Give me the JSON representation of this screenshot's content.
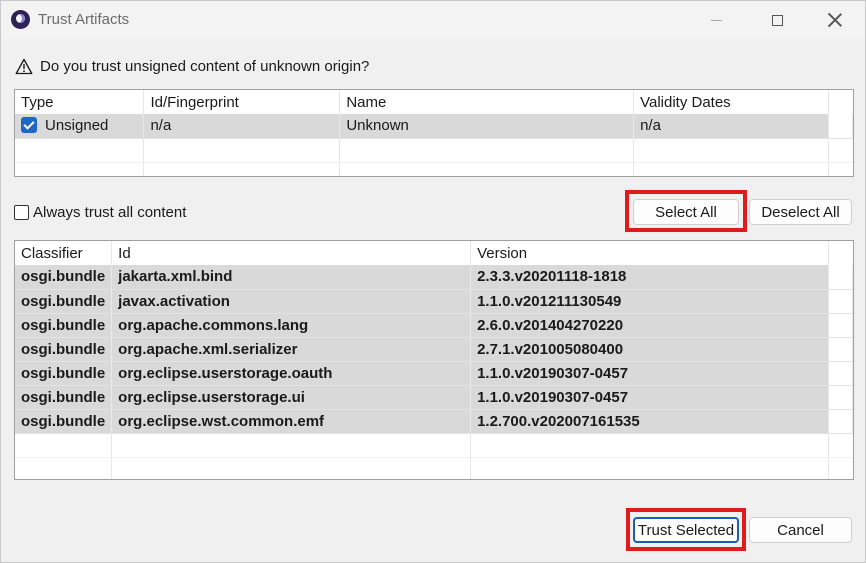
{
  "window": {
    "title": "Trust Artifacts"
  },
  "question": {
    "text": "Do you trust unsigned content of unknown origin?",
    "icon": "warning-triangle-icon"
  },
  "signers_table": {
    "columns": [
      "Type",
      "Id/Fingerprint",
      "Name",
      "Validity Dates"
    ],
    "rows": [
      {
        "type": "Unsigned",
        "checked": true,
        "id": "n/a",
        "name": "Unknown",
        "validity": "n/a"
      }
    ]
  },
  "always_trust": {
    "label": "Always trust all content",
    "checked": false
  },
  "buttons": {
    "select_all": "Select All",
    "deselect_all": "Deselect All",
    "trust_selected": "Trust Selected",
    "cancel": "Cancel"
  },
  "artifacts_table": {
    "columns": [
      "Classifier",
      "Id",
      "Version"
    ],
    "rows": [
      {
        "classifier": "osgi.bundle",
        "id": "jakarta.xml.bind",
        "version": "2.3.3.v20201118-1818"
      },
      {
        "classifier": "osgi.bundle",
        "id": "javax.activation",
        "version": "1.1.0.v201211130549"
      },
      {
        "classifier": "osgi.bundle",
        "id": "org.apache.commons.lang",
        "version": "2.6.0.v201404270220"
      },
      {
        "classifier": "osgi.bundle",
        "id": "org.apache.xml.serializer",
        "version": "2.7.1.v201005080400"
      },
      {
        "classifier": "osgi.bundle",
        "id": "org.eclipse.userstorage.oauth",
        "version": "1.1.0.v20190307-0457"
      },
      {
        "classifier": "osgi.bundle",
        "id": "org.eclipse.userstorage.ui",
        "version": "1.1.0.v20190307-0457"
      },
      {
        "classifier": "osgi.bundle",
        "id": "org.eclipse.wst.common.emf",
        "version": "1.2.700.v202007161535"
      }
    ]
  },
  "colors": {
    "highlight": "#e01b1b",
    "selected_row": "#d9d9d9",
    "checkbox_accent": "#1e66c8"
  }
}
